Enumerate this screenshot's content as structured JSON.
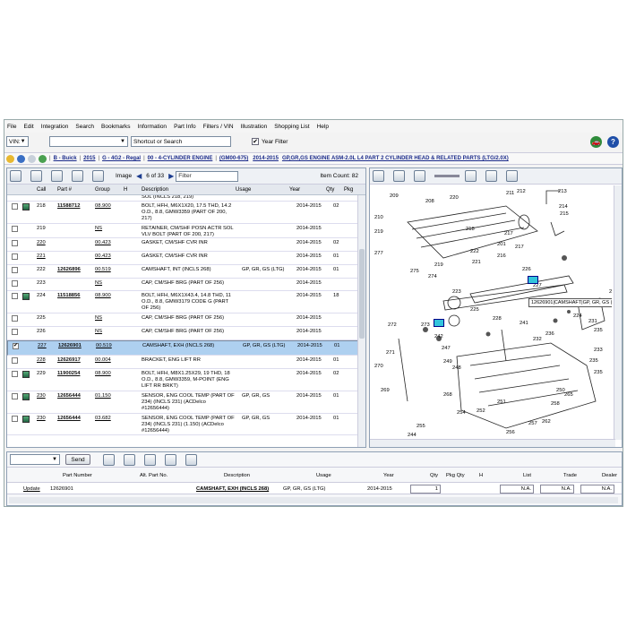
{
  "menu": [
    "File",
    "Edit",
    "Integration",
    "Search",
    "Bookmarks",
    "Information",
    "Part Info",
    "Filters / VIN",
    "Illustration",
    "Shopping List",
    "Help"
  ],
  "vin": {
    "label": "VIN:",
    "search_placeholder": "Shortcut or Search",
    "year_filter_label": "Year Filter",
    "year_filter_checked": true
  },
  "breadcrumb": [
    "B - Buick",
    "2015",
    "G - 4G2 - Regal",
    "00 - 4-CYLINDER ENGINE",
    "(GM00-675)",
    "2014-2015",
    "GP,GR,GS ENGINE ASM-2.0L L4 PART 2 CYLINDER HEAD & RELATED PARTS (LTG/2.0X)"
  ],
  "parts_toolbar": {
    "image_label": "Image",
    "image_pos": "6 of 33",
    "filter_placeholder": "Filter",
    "item_count": "Item Count: 82"
  },
  "columns": [
    "Call",
    "Part #",
    "Group",
    "H",
    "Description",
    "Usage",
    "Year",
    "Qty",
    "Pkg"
  ],
  "rows": [
    {
      "call": "",
      "part": "",
      "group": "",
      "desc": "SOL (INCLS 218, 219)",
      "usage": "",
      "year": "",
      "qty": "",
      "pkg": "",
      "book": false,
      "checked": false,
      "partial": true
    },
    {
      "call": "218",
      "part": "11588712",
      "group": "08.900",
      "desc": "BOLT, HFH, M6X1X20, 17.5 THD, 14.2 O.D., 8.8, GMW3359 (PART OF 200, 217)",
      "usage": "",
      "year": "2014-2015",
      "qty": "02",
      "pkg": "",
      "book": true,
      "checked": false
    },
    {
      "call": "219",
      "part": "",
      "group": "NS",
      "desc": "RETAINER, CM/SHF POSN ACTR SOL VLV BOLT (PART OF 200, 217)",
      "usage": "",
      "year": "2014-2015",
      "qty": "",
      "pkg": "",
      "book": false,
      "checked": false
    },
    {
      "call": "220",
      "part": "",
      "group": "00.423",
      "desc": "GASKET, CM/SHF CVR INR",
      "usage": "",
      "year": "2014-2015",
      "qty": "02",
      "pkg": "",
      "book": false,
      "checked": false
    },
    {
      "call": "221",
      "part": "",
      "group": "00.423",
      "desc": "GASKET, CM/SHF CVR INR",
      "usage": "",
      "year": "2014-2015",
      "qty": "01",
      "pkg": "",
      "book": false,
      "checked": false
    },
    {
      "call": "222",
      "part": "12626896",
      "group": "00.519",
      "desc": "CAMSHAFT, INT (INCLS 268)",
      "usage": "GP, GR, GS (LTG)",
      "year": "2014-2015",
      "qty": "01",
      "pkg": "",
      "book": false,
      "checked": false
    },
    {
      "call": "223",
      "part": "",
      "group": "NS",
      "desc": "CAP, CM/SHF BRG (PART OF 256)",
      "usage": "",
      "year": "2014-2015",
      "qty": "",
      "pkg": "",
      "book": false,
      "checked": false
    },
    {
      "call": "224",
      "part": "11518856",
      "group": "08.900",
      "desc": "BOLT, HFH, M6X1X43.4, 14.8 THD, 11 O.D., 8.8, GMW3179 CODE G (PART OF 256)",
      "usage": "",
      "year": "2014-2015",
      "qty": "18",
      "pkg": "",
      "book": true,
      "checked": false
    },
    {
      "call": "225",
      "part": "",
      "group": "NS",
      "desc": "CAP, CM/SHF BRG (PART OF 256)",
      "usage": "",
      "year": "2014-2015",
      "qty": "",
      "pkg": "",
      "book": false,
      "checked": false
    },
    {
      "call": "226",
      "part": "",
      "group": "NS",
      "desc": "CAP, CM/SHF BRG (PART OF 256)",
      "usage": "",
      "year": "2014-2015",
      "qty": "",
      "pkg": "",
      "book": false,
      "checked": false
    },
    {
      "call": "227",
      "part": "12626901",
      "group": "00.519",
      "desc": "CAMSHAFT, EXH (INCLS 268)",
      "usage": "GP, GR, GS (LTG)",
      "year": "2014-2015",
      "qty": "01",
      "pkg": "",
      "book": false,
      "checked": true,
      "selected": true
    },
    {
      "call": "228",
      "part": "12626917",
      "group": "00.004",
      "desc": "BRACKET, ENG LIFT RR",
      "usage": "",
      "year": "2014-2015",
      "qty": "01",
      "pkg": "",
      "book": false,
      "checked": false
    },
    {
      "call": "229",
      "part": "11900254",
      "group": "08.900",
      "desc": "BOLT, HFH, M8X1.25X29, 19 THD, 18 O.D., 8.8, GMW3359, M-POINT (ENG LIFT RR BRKT)",
      "usage": "",
      "year": "2014-2015",
      "qty": "02",
      "pkg": "",
      "book": true,
      "checked": false
    },
    {
      "call": "230",
      "part": "12656444",
      "group": "01.150",
      "desc": "SENSOR, ENG COOL TEMP (PART OF 234) (INCLS 231) (ACDelco #12656444)",
      "usage": "GP, GR, GS",
      "year": "2014-2015",
      "qty": "01",
      "pkg": "",
      "book": true,
      "checked": false
    },
    {
      "call": "230",
      "part": "12656444",
      "group": "03.682",
      "desc": "SENSOR, ENG COOL TEMP (PART OF 234) (INCLS 231) (1.150) (ACDelco #12656444)",
      "usage": "GP, GR, GS",
      "year": "2014-2015",
      "qty": "01",
      "pkg": "",
      "book": true,
      "checked": false
    }
  ],
  "diagram": {
    "callouts": [
      "209",
      "211",
      "212",
      "213",
      "208",
      "214",
      "215",
      "219",
      "220",
      "210",
      "218",
      "217",
      "201",
      "222",
      "277",
      "216",
      "221",
      "219",
      "217",
      "275",
      "274",
      "226",
      "227",
      "223",
      "230",
      "225",
      "224",
      "228",
      "231",
      "235",
      "272",
      "273",
      "242",
      "241",
      "236",
      "232",
      "271",
      "247",
      "249",
      "270",
      "233",
      "235",
      "248",
      "235",
      "269",
      "250",
      "251",
      "252",
      "254",
      "258",
      "255",
      "244",
      "268",
      "265",
      "262",
      "256",
      "257"
    ],
    "highlight_label": "227",
    "tooltip": "12626901|CAMSHAFT|GP, GR, GS (LTG)"
  },
  "shopping": {
    "send_label": "Send",
    "columns": [
      "Part Number",
      "Alt. Part No.",
      "Description",
      "Usage",
      "Year",
      "Qty",
      "Pkg Qty",
      "H",
      "List",
      "Trade",
      "Dealer"
    ],
    "row": {
      "action": "Update",
      "part": "12626901",
      "alt": "",
      "desc": "CAMSHAFT, EXH (INCLS 268)",
      "usage": "GP, GR, GS (LTG)",
      "year": "2014-2015",
      "qty": "1",
      "list": "N.A.",
      "trade": "N.A.",
      "dealer": "N.A."
    }
  },
  "colors": {
    "selected_row": "#aed0f0",
    "link": "#1a2a8a",
    "highlight": "#33c5dc"
  }
}
